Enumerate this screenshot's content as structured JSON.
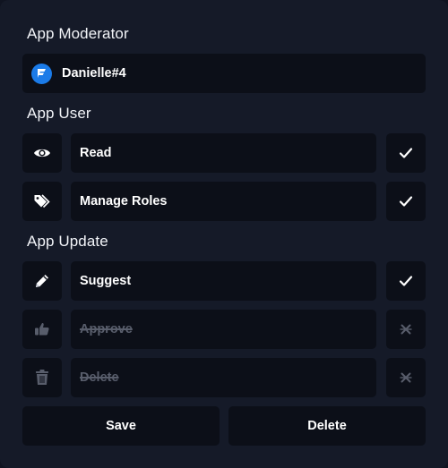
{
  "moderator": {
    "title": "App Moderator",
    "user": "Danielle#4"
  },
  "app_user": {
    "title": "App User",
    "permissions": [
      {
        "label": "Read",
        "icon": "eye-icon",
        "enabled": true
      },
      {
        "label": "Manage Roles",
        "icon": "tags-icon",
        "enabled": true
      }
    ]
  },
  "app_update": {
    "title": "App Update",
    "permissions": [
      {
        "label": "Suggest",
        "icon": "pencil-icon",
        "enabled": true
      },
      {
        "label": "Approve",
        "icon": "thumbs-up-icon",
        "enabled": false
      },
      {
        "label": "Delete",
        "icon": "trash-icon",
        "enabled": false
      }
    ]
  },
  "actions": {
    "save_label": "Save",
    "delete_label": "Delete"
  },
  "colors": {
    "panel_bg": "#151a28",
    "box_bg": "#0c0f18",
    "avatar": "#1b7be8",
    "disabled_text": "#585d6b"
  }
}
